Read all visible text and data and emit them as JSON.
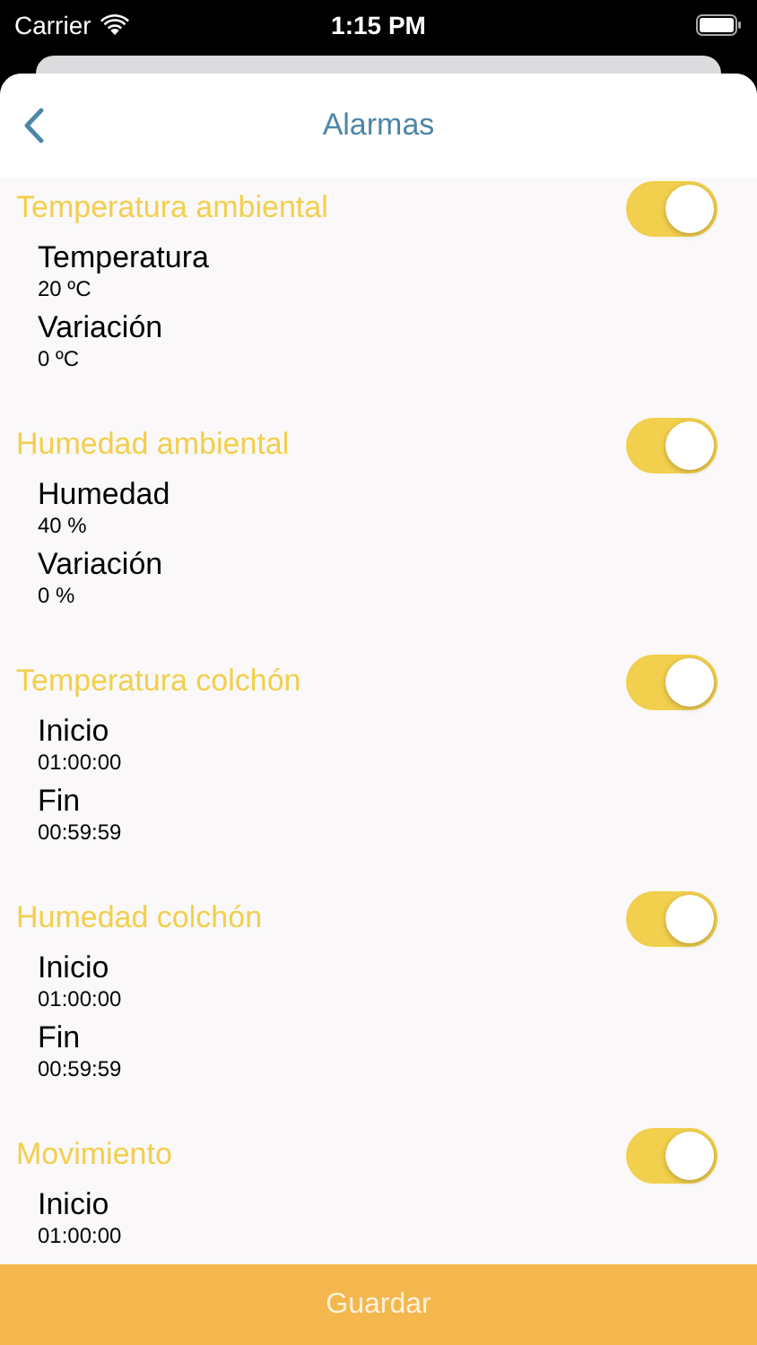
{
  "status_bar": {
    "carrier": "Carrier",
    "time": "1:15 PM"
  },
  "nav": {
    "title": "Alarmas"
  },
  "sections": [
    {
      "title": "Temperatura ambiental",
      "on": true,
      "items": [
        {
          "label": "Temperatura",
          "value": "20 ºC"
        },
        {
          "label": "Variación",
          "value": "0 ºC"
        }
      ]
    },
    {
      "title": "Humedad ambiental",
      "on": true,
      "items": [
        {
          "label": "Humedad",
          "value": "40 %"
        },
        {
          "label": "Variación",
          "value": "0 %"
        }
      ]
    },
    {
      "title": "Temperatura colchón",
      "on": true,
      "items": [
        {
          "label": "Inicio",
          "value": "01:00:00"
        },
        {
          "label": "Fin",
          "value": "00:59:59"
        }
      ]
    },
    {
      "title": "Humedad colchón",
      "on": true,
      "items": [
        {
          "label": "Inicio",
          "value": "01:00:00"
        },
        {
          "label": "Fin",
          "value": "00:59:59"
        }
      ]
    },
    {
      "title": "Movimiento",
      "on": true,
      "items": [
        {
          "label": "Inicio",
          "value": "01:00:00"
        }
      ]
    }
  ],
  "save_button": "Guardar"
}
